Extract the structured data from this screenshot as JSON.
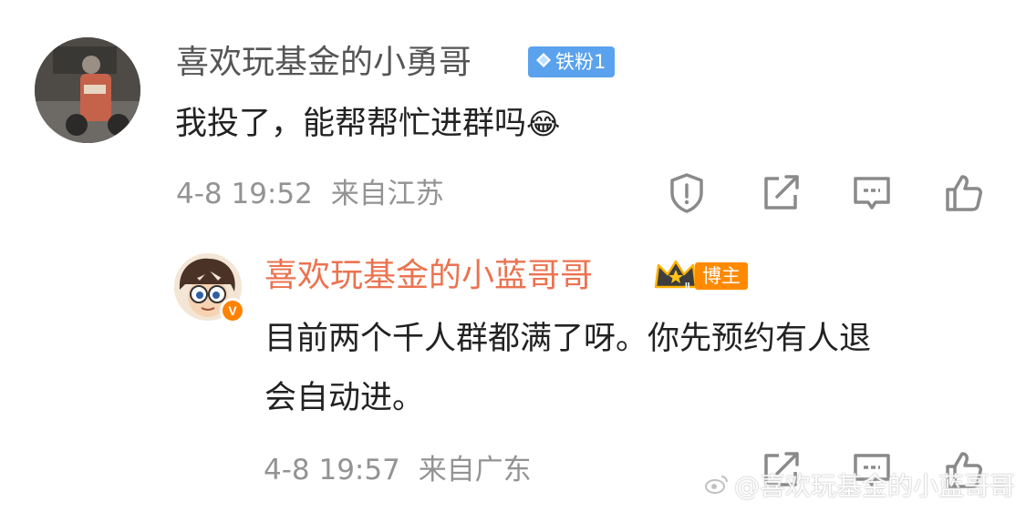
{
  "comments": [
    {
      "username": "喜欢玩基金的小勇哥",
      "badge": "铁粉1",
      "text": "我投了，能帮帮忙进群吗",
      "emoji": "😂",
      "time": "4-8 19:52",
      "location": "来自江苏",
      "icons": [
        "report-icon",
        "share-icon",
        "comment-icon",
        "like-icon"
      ]
    },
    {
      "username": "喜欢玩基金的小蓝哥哥",
      "badge_rank": "II",
      "badge": "博主",
      "verified": "V",
      "text_line1": "目前两个千人群都满了呀。你先预约有人退",
      "text_line2": "会自动进。",
      "time": "4-8 19:57",
      "location": "来自广东",
      "icons": [
        "share-icon",
        "comment-icon",
        "like-icon"
      ]
    }
  ],
  "watermark": "@喜欢玩基金的小蓝哥哥",
  "colors": {
    "accent": "#eb7350",
    "fan_badge": "#5aa2ed",
    "blogger": "#ff8a00",
    "meta": "#939393"
  }
}
